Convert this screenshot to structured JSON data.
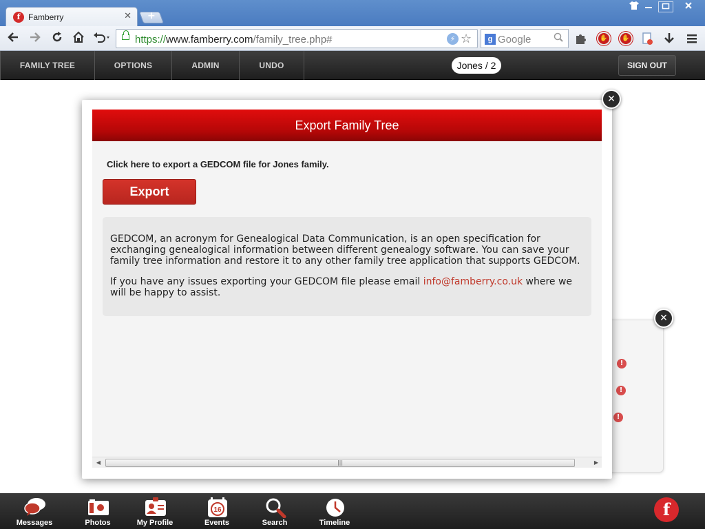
{
  "browser": {
    "tab_title": "Famberry",
    "tab_favicon_letter": "f",
    "url_scheme": "https://",
    "url_host": "www.famberry.com",
    "url_path": "/family_tree.php#",
    "search_placeholder": "Google",
    "search_engine_letter": "g"
  },
  "nav": {
    "items": [
      {
        "label": "FAMILY TREE"
      },
      {
        "label": "OPTIONS"
      },
      {
        "label": "ADMIN"
      },
      {
        "label": "UNDO"
      }
    ],
    "tree_badge": "Jones / 2",
    "sign_out": "SIGN OUT"
  },
  "modal": {
    "title": "Export Family Tree",
    "prompt": "Click here to export a GEDCOM file for Jones family.",
    "export_button": "Export",
    "info_paragraph_1": "GEDCOM, an acronym for Genealogical Data Communication, is an open specification for exchanging genealogical information between different genealogy software. You can save your family tree information and restore it to any other family tree application that supports GEDCOM.",
    "info_paragraph_2_before": "If you have any issues exporting your GEDCOM file please email ",
    "info_email": "info@famberry.co.uk",
    "info_paragraph_2_after": " where we will be happy to assist.",
    "close_glyph": "✕",
    "scroll_grip": "|||"
  },
  "background_panel": {
    "warning_glyph": "!",
    "close_glyph": "✕"
  },
  "dock": {
    "items": [
      {
        "label": "Messages",
        "icon": "messages-icon"
      },
      {
        "label": "Photos",
        "icon": "camera-icon"
      },
      {
        "label": "My Profile",
        "icon": "profile-card-icon"
      },
      {
        "label": "Events",
        "icon": "calendar-icon",
        "icon_text": "16"
      },
      {
        "label": "Search",
        "icon": "magnifier-icon"
      },
      {
        "label": "Timeline",
        "icon": "clock-icon"
      }
    ],
    "logo_letter": "f"
  },
  "colors": {
    "brand_red": "#d8282c",
    "header_red": "#c20909",
    "link_red": "#c0392b",
    "nav_dark": "#2a2a2a",
    "url_green": "#2e8b2e"
  }
}
